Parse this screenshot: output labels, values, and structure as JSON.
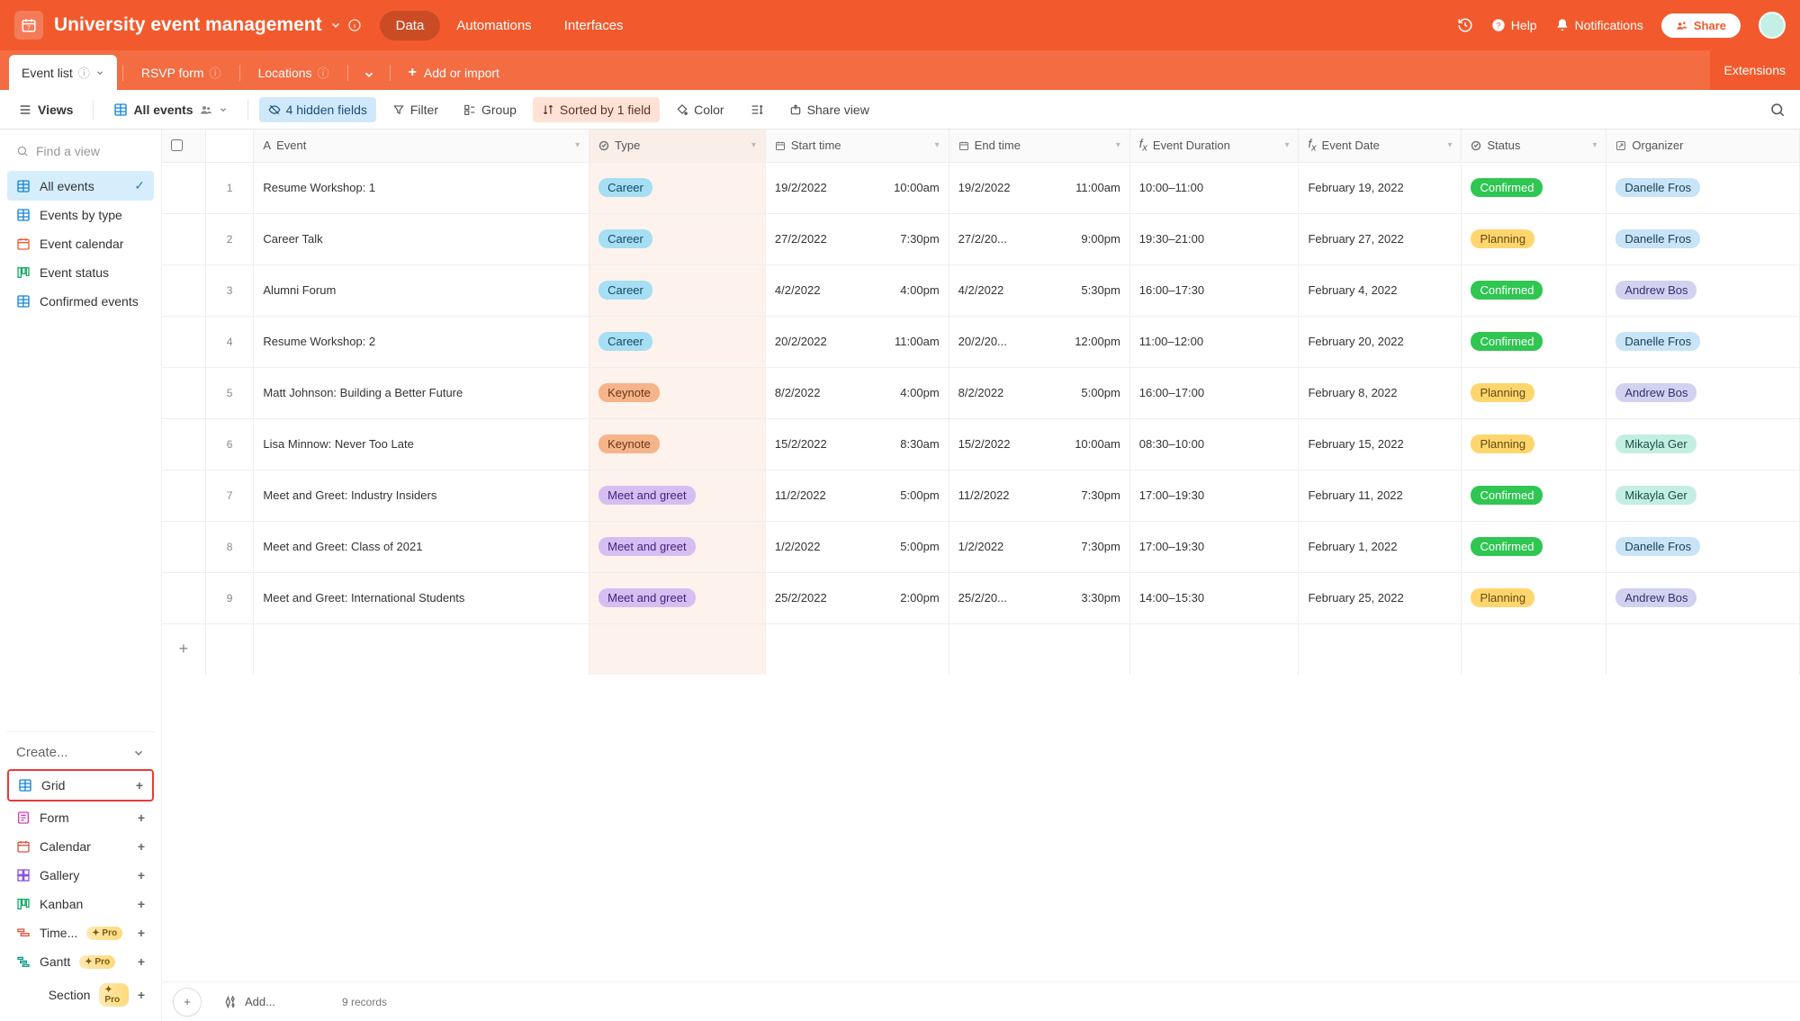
{
  "header": {
    "base_name": "University event management",
    "tabs": [
      "Data",
      "Automations",
      "Interfaces"
    ],
    "help": "Help",
    "notifications": "Notifications",
    "share": "Share"
  },
  "tables_bar": {
    "tabs": [
      {
        "label": "Event list",
        "active": true
      },
      {
        "label": "RSVP form",
        "active": false
      },
      {
        "label": "Locations",
        "active": false
      }
    ],
    "add_or_import": "Add or import",
    "extensions": "Extensions"
  },
  "toolbar": {
    "views_label": "Views",
    "current_view": "All events",
    "hidden_fields": "4 hidden fields",
    "filter": "Filter",
    "group": "Group",
    "sorted": "Sorted by 1 field",
    "color": "Color",
    "share_view": "Share view"
  },
  "sidebar": {
    "find_placeholder": "Find a view",
    "views": [
      {
        "name": "All events",
        "icon": "grid",
        "color": "blue",
        "active": true
      },
      {
        "name": "Events by type",
        "icon": "grid",
        "color": "blue"
      },
      {
        "name": "Event calendar",
        "icon": "calendar",
        "color": "orange"
      },
      {
        "name": "Event status",
        "icon": "kanban",
        "color": "green"
      },
      {
        "name": "Confirmed events",
        "icon": "grid",
        "color": "blue"
      }
    ],
    "create_label": "Create...",
    "create_items": [
      {
        "name": "Grid",
        "icon_class": "grid-icon",
        "highlight": true
      },
      {
        "name": "Form",
        "icon_class": "ci-pink"
      },
      {
        "name": "Calendar",
        "icon_class": "ci-red"
      },
      {
        "name": "Gallery",
        "icon_class": "ci-purple"
      },
      {
        "name": "Kanban",
        "icon_class": "ci-green"
      },
      {
        "name": "Time...",
        "icon_class": "ci-red",
        "pro": true
      },
      {
        "name": "Gantt",
        "icon_class": "ci-teal",
        "pro": true
      },
      {
        "name": "Section",
        "icon_class": "",
        "pro": true,
        "indent": true
      }
    ],
    "pro_label": "Pro"
  },
  "columns": [
    "Event",
    "Type",
    "Start time",
    "End time",
    "Event Duration",
    "Event Date",
    "Status",
    "Organizer"
  ],
  "rows": [
    {
      "n": 1,
      "event": "Resume Workshop: 1",
      "type": "Career",
      "type_class": "pill-career",
      "start_d": "19/2/2022",
      "start_t": "10:00am",
      "end_d": "19/2/2022",
      "end_t": "11:00am",
      "duration": "10:00–11:00",
      "date": "February 19, 2022",
      "status": "Confirmed",
      "status_class": "pill-confirmed",
      "organizer": "Danelle Fros",
      "org_class": "pill-blue"
    },
    {
      "n": 2,
      "event": "Career Talk",
      "type": "Career",
      "type_class": "pill-career",
      "start_d": "27/2/2022",
      "start_t": "7:30pm",
      "end_d": "27/2/20...",
      "end_t": "9:00pm",
      "duration": "19:30–21:00",
      "date": "February 27, 2022",
      "status": "Planning",
      "status_class": "pill-planning",
      "organizer": "Danelle Fros",
      "org_class": "pill-blue"
    },
    {
      "n": 3,
      "event": "Alumni Forum",
      "type": "Career",
      "type_class": "pill-career",
      "start_d": "4/2/2022",
      "start_t": "4:00pm",
      "end_d": "4/2/2022",
      "end_t": "5:30pm",
      "duration": "16:00–17:30",
      "date": "February 4, 2022",
      "status": "Confirmed",
      "status_class": "pill-confirmed",
      "organizer": "Andrew Bos",
      "org_class": "pill-lav"
    },
    {
      "n": 4,
      "event": "Resume Workshop: 2",
      "type": "Career",
      "type_class": "pill-career",
      "start_d": "20/2/2022",
      "start_t": "11:00am",
      "end_d": "20/2/20...",
      "end_t": "12:00pm",
      "duration": "11:00–12:00",
      "date": "February 20, 2022",
      "status": "Confirmed",
      "status_class": "pill-confirmed",
      "organizer": "Danelle Fros",
      "org_class": "pill-blue"
    },
    {
      "n": 5,
      "event": "Matt Johnson: Building a Better Future",
      "type": "Keynote",
      "type_class": "pill-keynote",
      "start_d": "8/2/2022",
      "start_t": "4:00pm",
      "end_d": "8/2/2022",
      "end_t": "5:00pm",
      "duration": "16:00–17:00",
      "date": "February 8, 2022",
      "status": "Planning",
      "status_class": "pill-planning",
      "organizer": "Andrew Bos",
      "org_class": "pill-lav"
    },
    {
      "n": 6,
      "event": "Lisa Minnow: Never Too Late",
      "type": "Keynote",
      "type_class": "pill-keynote",
      "start_d": "15/2/2022",
      "start_t": "8:30am",
      "end_d": "15/2/2022",
      "end_t": "10:00am",
      "duration": "08:30–10:00",
      "date": "February 15, 2022",
      "status": "Planning",
      "status_class": "pill-planning",
      "organizer": "Mikayla Ger",
      "org_class": "pill-mint"
    },
    {
      "n": 7,
      "event": "Meet and Greet: Industry Insiders",
      "type": "Meet and greet",
      "type_class": "pill-meet",
      "start_d": "11/2/2022",
      "start_t": "5:00pm",
      "end_d": "11/2/2022",
      "end_t": "7:30pm",
      "duration": "17:00–19:30",
      "date": "February 11, 2022",
      "status": "Confirmed",
      "status_class": "pill-confirmed",
      "organizer": "Mikayla Ger",
      "org_class": "pill-mint"
    },
    {
      "n": 8,
      "event": "Meet and Greet: Class of 2021",
      "type": "Meet and greet",
      "type_class": "pill-meet",
      "start_d": "1/2/2022",
      "start_t": "5:00pm",
      "end_d": "1/2/2022",
      "end_t": "7:30pm",
      "duration": "17:00–19:30",
      "date": "February 1, 2022",
      "status": "Confirmed",
      "status_class": "pill-confirmed",
      "organizer": "Danelle Fros",
      "org_class": "pill-blue"
    },
    {
      "n": 9,
      "event": "Meet and Greet: International Students",
      "type": "Meet and greet",
      "type_class": "pill-meet",
      "start_d": "25/2/2022",
      "start_t": "2:00pm",
      "end_d": "25/2/20...",
      "end_t": "3:30pm",
      "duration": "14:00–15:30",
      "date": "February 25, 2022",
      "status": "Planning",
      "status_class": "pill-planning",
      "organizer": "Andrew Bos",
      "org_class": "pill-lav"
    }
  ],
  "footer": {
    "add_label": "Add...",
    "record_count": "9 records"
  }
}
